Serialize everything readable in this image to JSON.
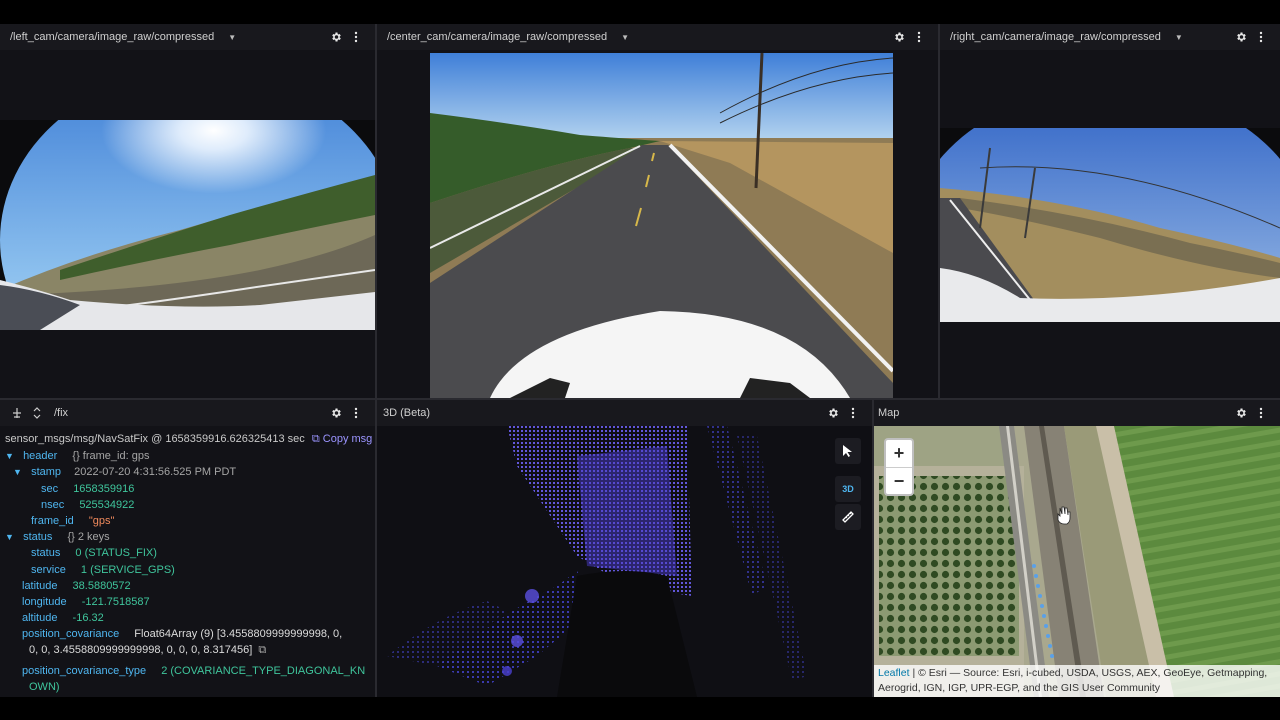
{
  "panels": {
    "left_cam": {
      "topic": "/left_cam/camera/image_raw/compressed"
    },
    "center_cam": {
      "topic": "/center_cam/camera/image_raw/compressed"
    },
    "right_cam": {
      "topic": "/right_cam/camera/image_raw/compressed"
    },
    "raw_message": {
      "topic": "/fix",
      "schema_line": "sensor_msgs/msg/NavSatFix @ 1658359916.626325413 sec",
      "copy_label": "Copy msg",
      "rows": {
        "header_key": "header",
        "header_summary": "{}  frame_id: gps",
        "stamp_key": "stamp",
        "stamp_value": "2022-07-20 4:31:56.525 PM PDT",
        "sec_key": "sec",
        "sec_value": "1658359916",
        "nsec_key": "nsec",
        "nsec_value": "525534922",
        "frame_id_key": "frame_id",
        "frame_id_value": "\"gps\"",
        "status_key": "status",
        "status_summary": "{}  2 keys",
        "status_status_key": "status",
        "status_status_value": "0 (STATUS_FIX)",
        "service_key": "service",
        "service_value": "1 (SERVICE_GPS)",
        "latitude_key": "latitude",
        "latitude_value": "38.5880572",
        "longitude_key": "longitude",
        "longitude_value": "-121.7518587",
        "altitude_key": "altitude",
        "altitude_value": "-16.32",
        "cov_key": "position_covariance",
        "cov_value_1": "Float64Array (9) [3.4558809999999998, 0,",
        "cov_value_2": "0, 0, 3.4558809999999998, 0, 0, 0, 8.317456]",
        "cov_type_key": "position_covariance_type",
        "cov_type_value_1": "2 (COVARIANCE_TYPE_DIAGONAL_KN",
        "cov_type_value_2": "OWN)"
      }
    },
    "three_d": {
      "title": "3D (Beta)",
      "mode_3d_label": "3D"
    },
    "map": {
      "title": "Map",
      "zoom_in": "+",
      "zoom_out": "−",
      "attribution_link": "Leaflet",
      "attribution_text_1": " | © Esri — Source: Esri, i-cubed, USDA, USGS, AEX, GeoEye, Getmapping,",
      "attribution_text_2": "Aerogrid, IGN, IGP, UPR-EGP, and the GIS User Community"
    }
  },
  "colors": {
    "panel_bg": "#121217",
    "header_bg": "#18181d",
    "key": "#4fb6f0",
    "value": "#3fc59c",
    "string": "#f08a5d",
    "accent": "#9b94ff"
  }
}
